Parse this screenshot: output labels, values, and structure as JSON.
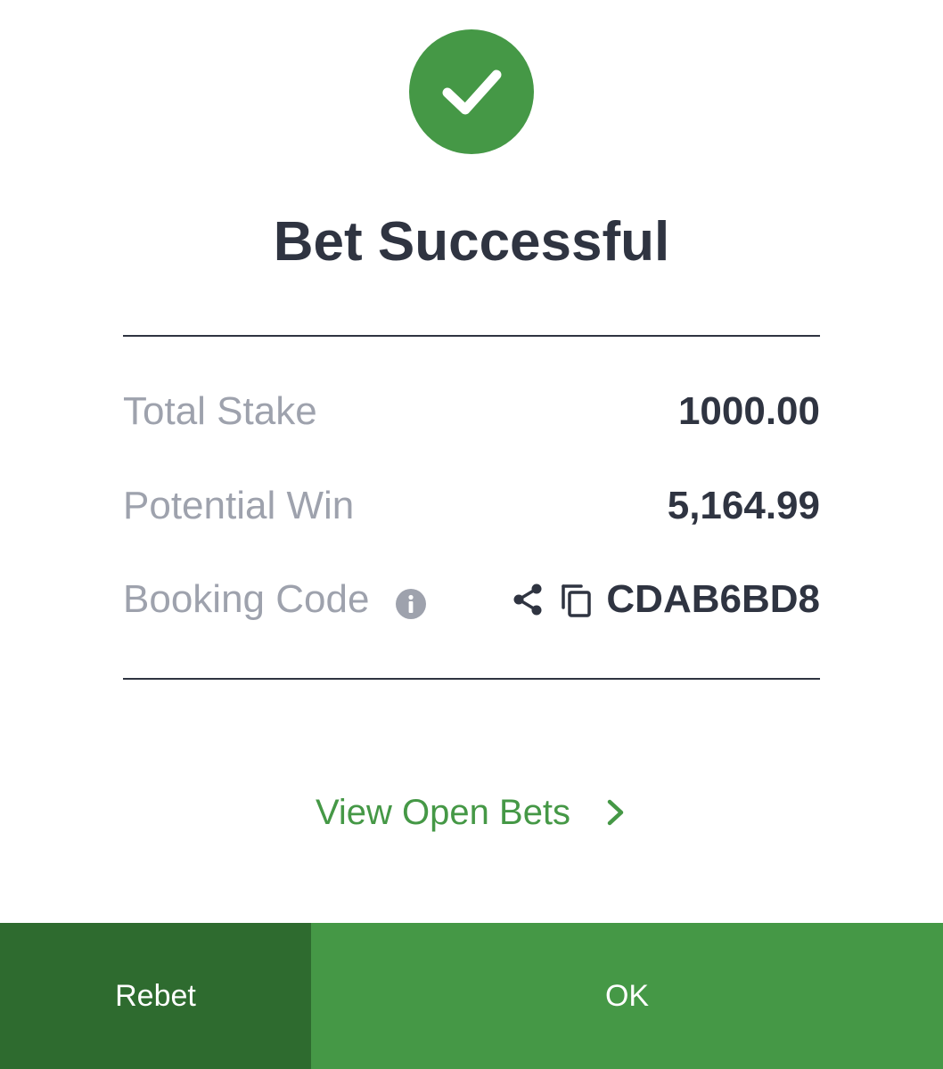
{
  "dialog": {
    "title": "Bet Successful",
    "icon": "check-circle-icon",
    "accent_color": "#459846",
    "dark_accent_color": "#2e6b2f"
  },
  "summary": {
    "total_stake_label": "Total Stake",
    "total_stake_value": "1000.00",
    "potential_win_label": "Potential Win",
    "potential_win_value": "5,164.99",
    "booking_code_label": "Booking Code",
    "booking_code_value": "CDAB6BD8",
    "icons": [
      "info-icon",
      "share-icon",
      "copy-icon"
    ]
  },
  "links": {
    "view_open_bets": "View Open Bets"
  },
  "footer": {
    "rebet_label": "Rebet",
    "ok_label": "OK"
  }
}
